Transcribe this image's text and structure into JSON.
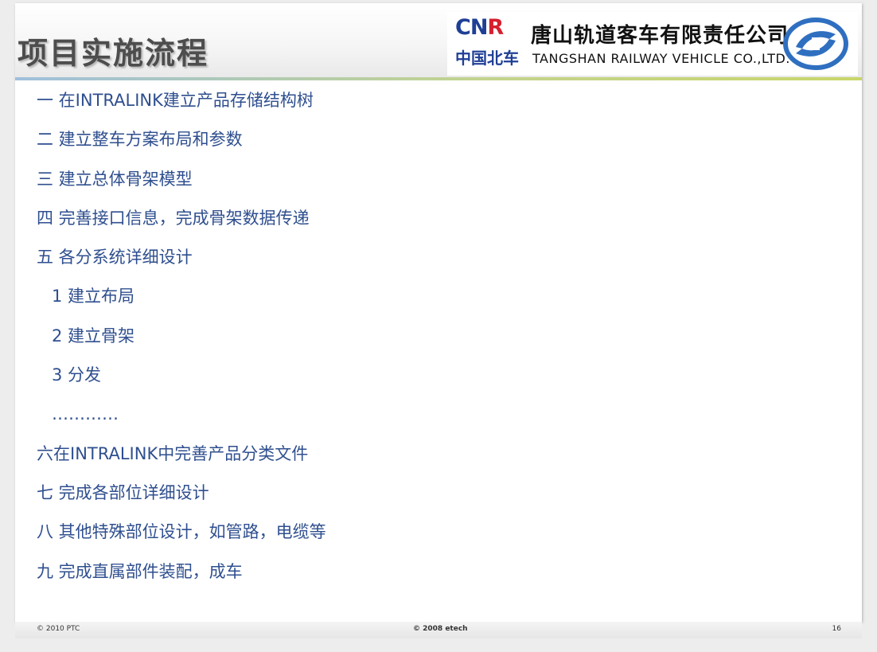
{
  "slide": {
    "title": "项目实施流程",
    "logo": {
      "brand_latin": "CNR",
      "brand_latin_main": "CN",
      "brand_latin_accent": "R",
      "brand_zh": "中国北车",
      "company_zh": "唐山轨道客车有限责任公司",
      "company_en": "TANGSHAN RAILWAY VEHICLE CO.,LTD.",
      "emblem_icon": "company-emblem-icon"
    },
    "items": [
      {
        "text": "一 在INTRALINK建立产品存储结构树",
        "level": 0
      },
      {
        "text": "二 建立整车方案布局和参数",
        "level": 0
      },
      {
        "text": "三 建立总体骨架模型",
        "level": 0
      },
      {
        "text": "四 完善接口信息，完成骨架数据传递",
        "level": 0
      },
      {
        "text": "五 各分系统详细设计",
        "level": 0
      },
      {
        "text": "1 建立布局",
        "level": 1
      },
      {
        "text": "2 建立骨架",
        "level": 1
      },
      {
        "text": "3 分发",
        "level": 1
      },
      {
        "text": "…………",
        "level": 1
      },
      {
        "text": "六在INTRALINK中完善产品分类文件",
        "level": 0
      },
      {
        "text": "七 完成各部位详细设计",
        "level": 0
      },
      {
        "text": "八 其他特殊部位设计，如管路，电缆等",
        "level": 0
      },
      {
        "text": "九 完成直属部件装配，成车",
        "level": 0
      }
    ]
  },
  "footer": {
    "left": "© 2010 PTC",
    "center": "© 2008 etech",
    "page_number": "16"
  },
  "colors": {
    "text": "#2f4f8f",
    "title": "#4d4d4d",
    "brand_blue": "#1f3f95",
    "brand_red": "#d6202e"
  }
}
